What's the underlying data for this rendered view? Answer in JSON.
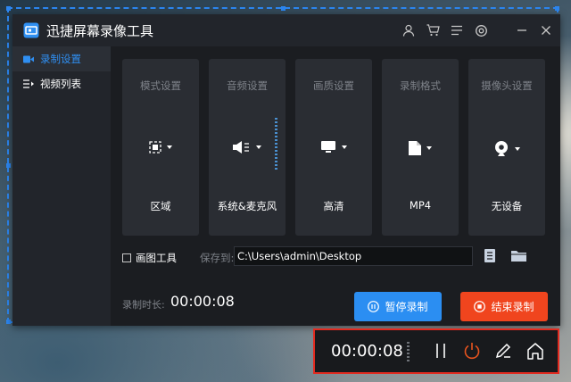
{
  "app": {
    "title": "迅捷屏幕录像工具",
    "accent": "#2f8ff2",
    "icons": [
      "user-icon",
      "cart-icon",
      "menu-icon",
      "settings-icon",
      "minimize-icon",
      "close-icon"
    ]
  },
  "sidebar": {
    "items": [
      {
        "label": "录制设置",
        "icon": "video-camera-icon",
        "active": true
      },
      {
        "label": "视频列表",
        "icon": "list-icon",
        "active": false
      }
    ]
  },
  "cards": [
    {
      "title": "模式设置",
      "value": "区域",
      "icon": "region-icon"
    },
    {
      "title": "音频设置",
      "value": "系统&麦克风",
      "icon": "speaker-icon"
    },
    {
      "title": "画质设置",
      "value": "高清",
      "icon": "monitor-icon"
    },
    {
      "title": "录制格式",
      "value": "MP4",
      "icon": "file-icon"
    },
    {
      "title": "摄像头设置",
      "value": "无设备",
      "icon": "webcam-icon"
    }
  ],
  "options": {
    "drawing_tool_label": "画图工具",
    "drawing_tool_checked": false,
    "save_to_label": "保存到:",
    "save_path": "C:\\Users\\admin\\Desktop"
  },
  "recording": {
    "duration_label": "录制时长:",
    "duration": "00:00:08",
    "pause_label": "暂停录制",
    "stop_label": "结束录制",
    "pause_color": "#2b8ef2",
    "stop_color": "#f0451e"
  },
  "floating_bar": {
    "time": "00:00:08",
    "border_color": "#e22b20",
    "icons": [
      "pause-icon",
      "power-icon",
      "pen-icon",
      "home-icon"
    ]
  }
}
